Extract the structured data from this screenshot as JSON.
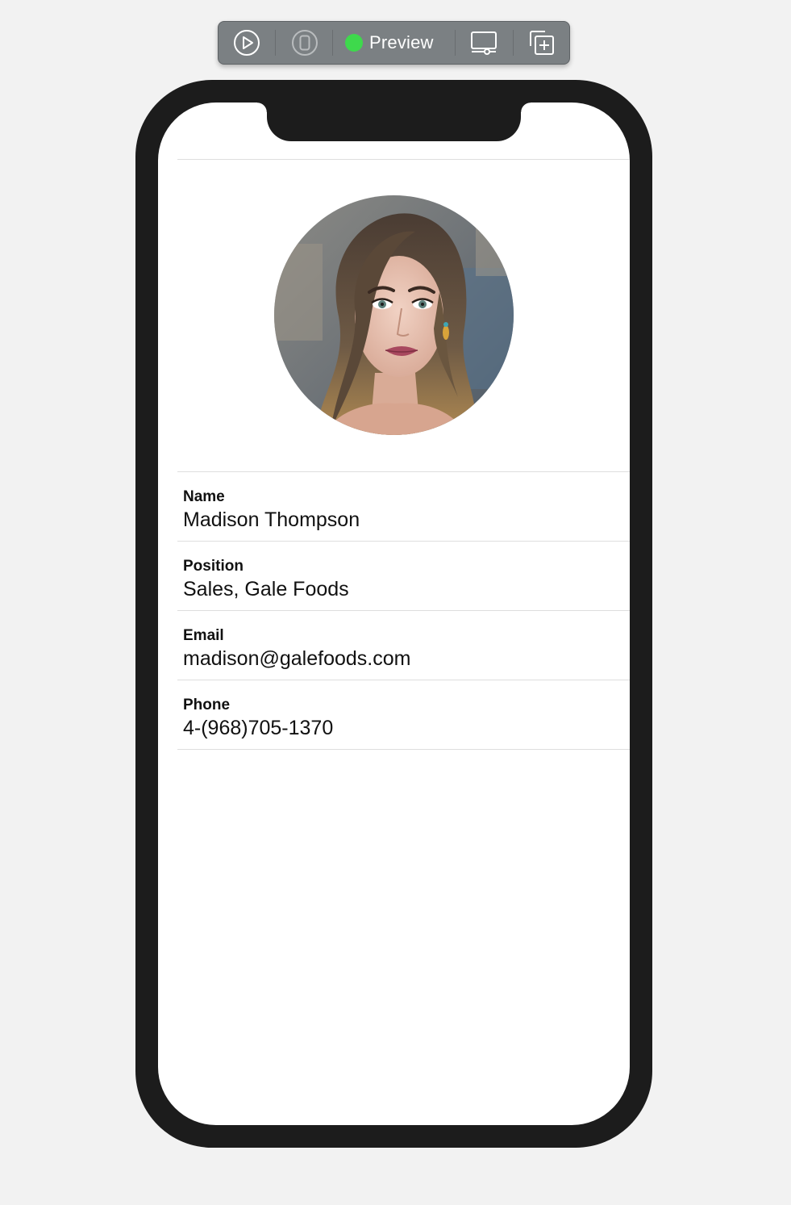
{
  "toolbar": {
    "live_preview_icon": "play-circle-icon",
    "device_icon": "device-icon",
    "preview_label": "Preview",
    "preview_status_color": "#3ed94c",
    "device_settings_icon": "display-settings-icon",
    "duplicate_icon": "duplicate-preview-icon"
  },
  "profile": {
    "avatar_icon": "profile-photo",
    "fields": [
      {
        "label": "Name",
        "value": "Madison Thompson"
      },
      {
        "label": "Position",
        "value": "Sales, Gale Foods"
      },
      {
        "label": "Email",
        "value": "madison@galefoods.com"
      },
      {
        "label": "Phone",
        "value": "4-(968)705-1370"
      }
    ]
  }
}
